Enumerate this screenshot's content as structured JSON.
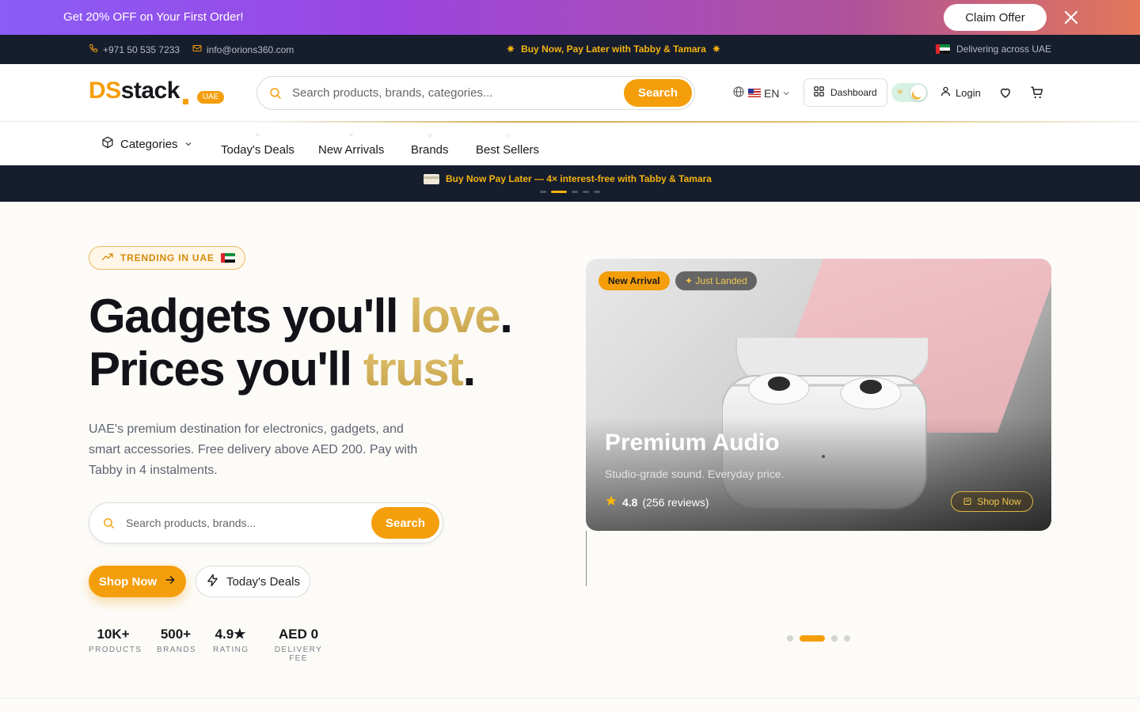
{
  "promo": {
    "text": "Get 20% OFF on Your First Order!",
    "claim_label": "Claim Offer"
  },
  "infobar": {
    "phone": "+971 50 535 7233",
    "email": "info@orions360.com",
    "center": "Buy Now, Pay Later with Tabby & Tamara",
    "right": "Delivering across UAE"
  },
  "header": {
    "logo_ds": "DS",
    "logo_stack": "stack",
    "region_badge": "UAE",
    "search_placeholder": "Search products, brands, categories...",
    "search_label": "Search",
    "language": "EN",
    "dashboard_label": "Dashboard",
    "login_label": "Login"
  },
  "nav": {
    "categories_label": "Categories",
    "items": [
      {
        "label": "Today's Deals"
      },
      {
        "label": "New Arrivals"
      },
      {
        "label": "Brands"
      },
      {
        "label": "Best Sellers"
      }
    ]
  },
  "bnpl": {
    "text": "Buy Now Pay Later — 4× interest-free with Tabby & Tamara",
    "active_dot": 1,
    "dot_count": 5
  },
  "hero": {
    "trend_label": "TRENDING IN UAE",
    "line1_a": "Gadgets you'll ",
    "line1_gold": "love",
    "line1_end": ".",
    "line2_a": "Prices you'll ",
    "line2_gold": "trust",
    "line2_end": ".",
    "description": "UAE's premium destination for electronics, gadgets, and smart accessories. Free delivery above AED 200. Pay with Tabby in 4 instalments.",
    "search_placeholder": "Search products, brands...",
    "search_label": "Search",
    "shop_label": "Shop Now",
    "deals_label": "Today's Deals",
    "stats": [
      {
        "value": "10K+",
        "label": "PRODUCTS"
      },
      {
        "value": "500+",
        "label": "BRANDS"
      },
      {
        "value": "4.9★",
        "label": "RATING"
      },
      {
        "value": "AED 0",
        "label": "DELIVERY FEE"
      }
    ]
  },
  "slide": {
    "tag_new": "New Arrival",
    "tag_landed": "✦ Just Landed",
    "title": "Premium Audio",
    "subtitle": "Studio-grade sound. Everyday price.",
    "rating": "4.8",
    "reviews": "(256 reviews)",
    "shop_label": "Shop Now",
    "active_dot": 1,
    "dot_count": 4
  },
  "colors": {
    "accent": "#f59e0b",
    "dark": "#161d2d",
    "gold": "#c6a24a"
  }
}
